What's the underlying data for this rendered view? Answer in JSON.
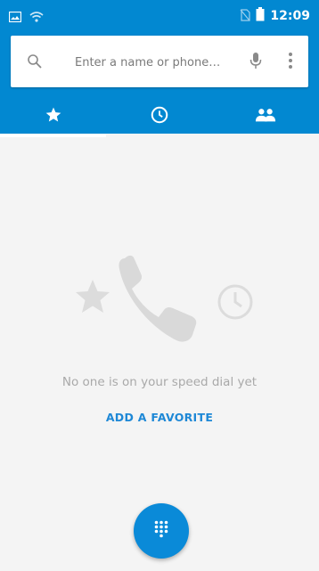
{
  "status_bar": {
    "time": "12:09",
    "left_icons": [
      "image-notification-icon",
      "wifi-notification-icon"
    ],
    "right_icons": [
      "no-sim-icon",
      "battery-icon"
    ]
  },
  "search": {
    "placeholder": "Enter a name or phone…",
    "value": "",
    "icons": [
      "search-icon",
      "mic-icon",
      "more-vert-icon"
    ]
  },
  "tabs": [
    {
      "id": "speed-dial",
      "icon": "star-icon",
      "selected": true
    },
    {
      "id": "recents",
      "icon": "clock-icon",
      "selected": false
    },
    {
      "id": "contacts",
      "icon": "people-icon",
      "selected": false
    }
  ],
  "empty_state": {
    "message": "No one is on your speed dial yet",
    "action_label": "ADD A FAVORITE"
  },
  "fab": {
    "icon": "dialpad-icon"
  },
  "colors": {
    "primary": "#0288d1",
    "accent": "#1e88d6",
    "background": "#f4f4f4",
    "empty_text": "#a9a9a9"
  }
}
